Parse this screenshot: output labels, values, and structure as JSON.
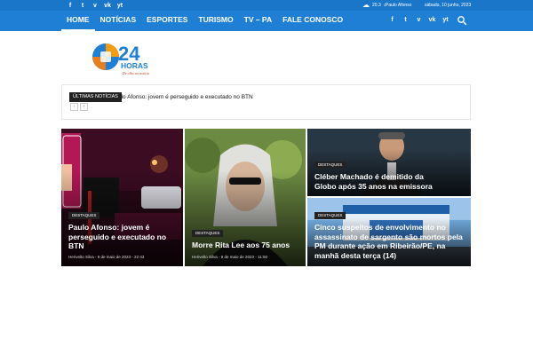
{
  "topbar": {
    "social": [
      "f",
      "t",
      "v",
      "vk",
      "yt"
    ],
    "weather_temp": "20.3",
    "weather_unit": "C",
    "city": "Paulo Afonso",
    "date": "sábado, 10 junho, 2023"
  },
  "nav": {
    "items": [
      {
        "label": "HOME",
        "active": true
      },
      {
        "label": "NOTÍCIAS"
      },
      {
        "label": "ESPORTES"
      },
      {
        "label": "TURISMO"
      },
      {
        "label": "TV – PA"
      },
      {
        "label": "FALE CONOSCO"
      }
    ],
    "social": [
      "f",
      "t",
      "v",
      "vk",
      "yt"
    ]
  },
  "logo": {
    "number": "24",
    "word": "HORAS",
    "tagline": "De olho na notícia"
  },
  "ticker": {
    "label": "ÚLTIMAS NOTÍCIAS",
    "text": "Paulo Afonso: jovem é perseguido e executado no BTN",
    "prev": "‹",
    "next": "›"
  },
  "featured": [
    {
      "badge": "DESTAQUES",
      "title": "Paulo Afonso: jovem é perseguido e executado no BTN",
      "author": "Herivelto Silva",
      "date": "9 de maio de 2023 - 22:43"
    },
    {
      "badge": "DESTAQUES",
      "title": "Morre Rita Lee aos 75 anos",
      "author": "Herivelto Silva",
      "date": "9 de maio de 2023 - 11:50"
    },
    {
      "badge": "DESTAQUES",
      "title": "Cléber Machado é demitido da Globo após 35 anos na emissora"
    },
    {
      "badge": "DESTAQUES",
      "title": "Cinco suspeitos de envolvimento no assassinato de sargento são mortos pela PM durante ação em Ribeirão/PE, na manhã desta terça (14)"
    }
  ],
  "colors": {
    "brand_blue": "#1e7fd4",
    "top_blue": "#1976c9",
    "badge_bg": "#222222"
  }
}
